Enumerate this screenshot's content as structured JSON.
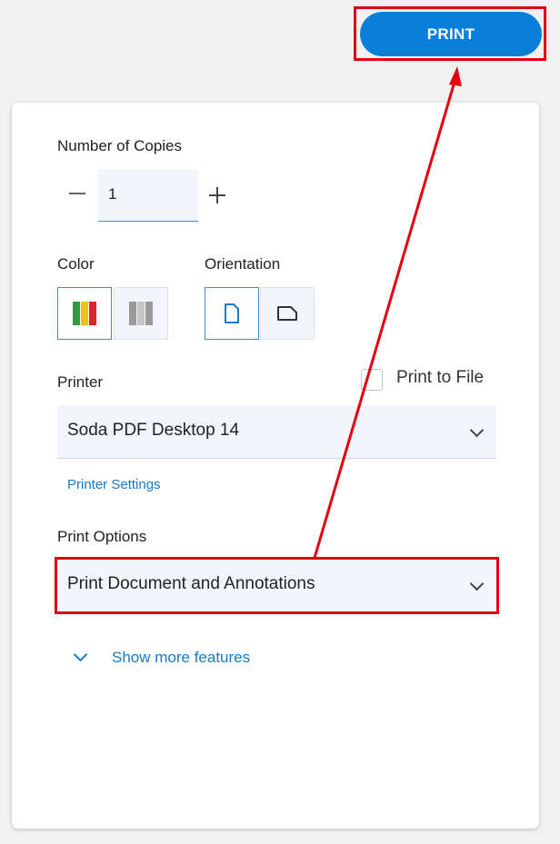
{
  "header": {
    "print_label": "PRINT"
  },
  "copies": {
    "label": "Number of Copies",
    "value": "1"
  },
  "color": {
    "label": "Color",
    "options": [
      {
        "name": "color",
        "icon": "color-bars-icon",
        "selected": true,
        "stripes": [
          "#2e9c3f",
          "#f4c20d",
          "#e0242b"
        ]
      },
      {
        "name": "grayscale",
        "icon": "grayscale-bars-icon",
        "selected": false,
        "stripes": [
          "#9a9a9a",
          "#c6c6c6",
          "#9a9a9a"
        ]
      }
    ]
  },
  "orientation": {
    "label": "Orientation",
    "options": [
      {
        "name": "portrait",
        "icon": "portrait-page-icon",
        "selected": true
      },
      {
        "name": "landscape",
        "icon": "landscape-page-icon",
        "selected": false
      }
    ]
  },
  "printer": {
    "label": "Printer",
    "selected": "Soda PDF Desktop 14",
    "settings_link": "Printer Settings",
    "print_to_file_label": "Print to File",
    "print_to_file_checked": false
  },
  "print_options": {
    "label": "Print Options",
    "selected": "Print Document and Annotations"
  },
  "more_features": {
    "label": "Show more features"
  },
  "colors": {
    "accent": "#0a7fd9",
    "link": "#1a7ac4",
    "highlight": "#e4000f",
    "field_bg": "#f2f6fa"
  }
}
